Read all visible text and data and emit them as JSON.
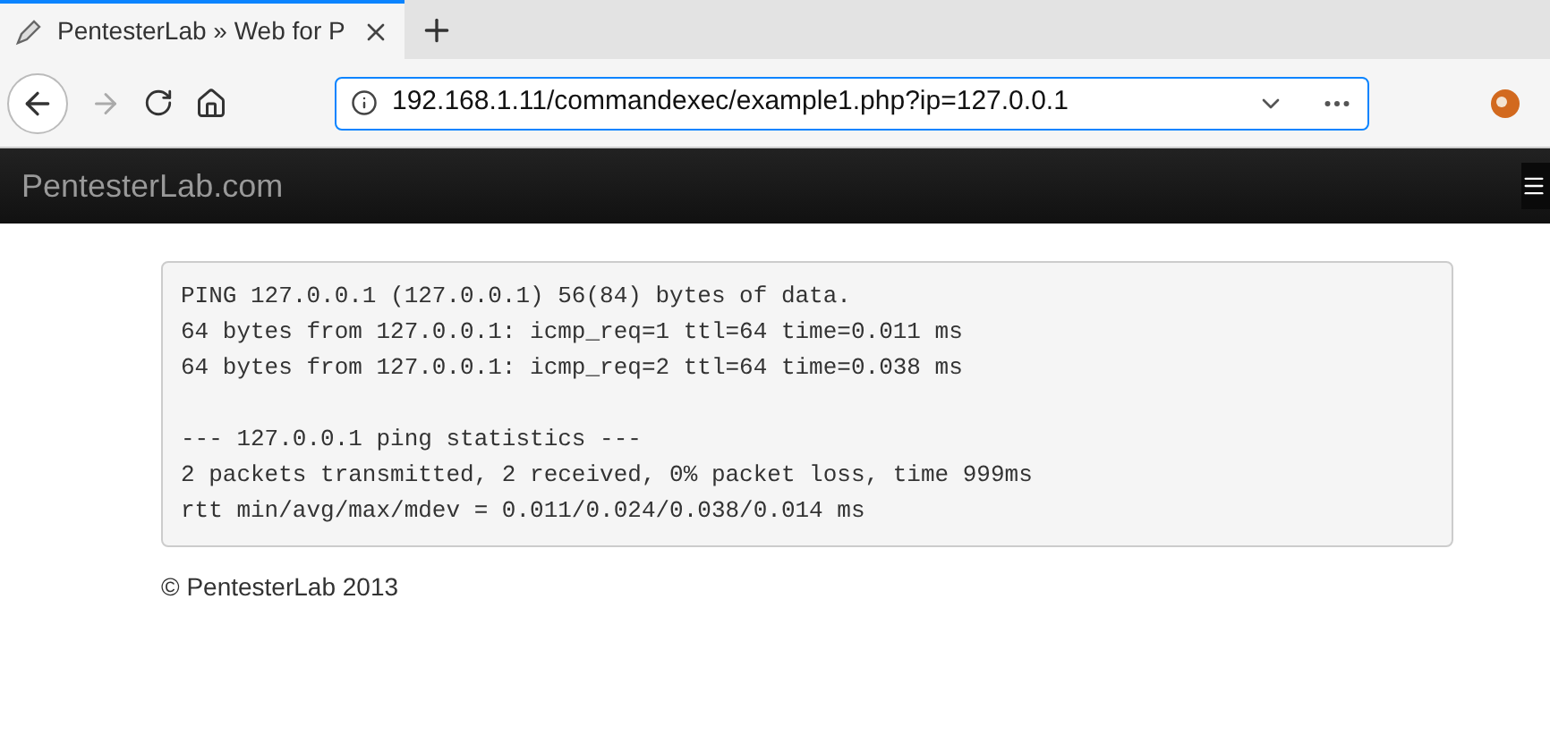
{
  "browser": {
    "tabs": [
      {
        "title": "PentesterLab » Web for P",
        "selected": true
      }
    ],
    "address": "192.168.1.11/commandexec/example1.php?ip=127.0.0.1"
  },
  "navbar": {
    "brand": "PentesterLab.com"
  },
  "output": "PING 127.0.0.1 (127.0.0.1) 56(84) bytes of data.\n64 bytes from 127.0.0.1: icmp_req=1 ttl=64 time=0.011 ms\n64 bytes from 127.0.0.1: icmp_req=2 ttl=64 time=0.038 ms\n\n--- 127.0.0.1 ping statistics ---\n2 packets transmitted, 2 received, 0% packet loss, time 999ms\nrtt min/avg/max/mdev = 0.011/0.024/0.038/0.014 ms",
  "footer": "© PentesterLab 2013"
}
